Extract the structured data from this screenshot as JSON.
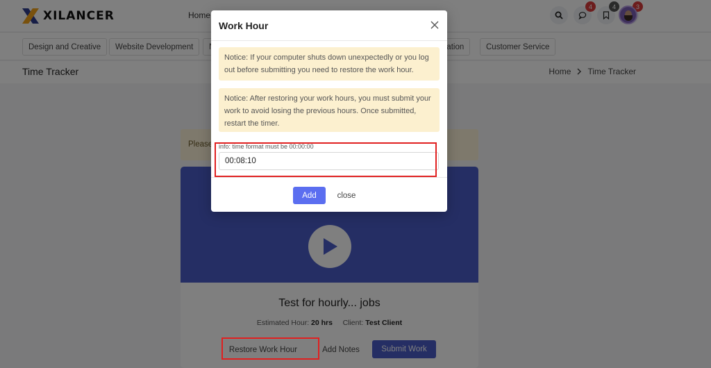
{
  "brand": {
    "name": "XILANCER"
  },
  "nav": {
    "home": "Home"
  },
  "header": {
    "search_icon": "search-icon",
    "messages": {
      "icon": "chat-icon",
      "count": "4"
    },
    "saved": {
      "icon": "bookmark-icon",
      "count": "4"
    },
    "notifications": {
      "icon": "bell-icon",
      "count": "3"
    }
  },
  "categories": [
    "Design and Creative",
    "Website Development",
    "N",
    "slation",
    "Customer Service"
  ],
  "page": {
    "title": "Time Tracker",
    "breadcrumb": [
      "Home",
      "Time Tracker"
    ]
  },
  "content": {
    "notice_prefix": "Please",
    "job_title": "Test for hourly... jobs",
    "estimated_label": "Estimated Hour:",
    "estimated_value": "20 hrs",
    "client_label": "Client:",
    "client_value": "Test Client",
    "restore_label": "Restore Work Hour",
    "notes_label": "Add Notes",
    "submit_label": "Submit Work"
  },
  "modal": {
    "title": "Work Hour",
    "notice1": "Notice: If your computer shuts down unexpectedly or you log out before submitting you need to restore the work hour.",
    "notice2": "Notice: After restoring your work hours, you must submit your work to avoid losing the previous hours. Once submitted, restart the timer.",
    "field_label": "info: time format must be 00:00:00",
    "field_value": "00:08:10",
    "add_label": "Add",
    "close_label": "close"
  },
  "colors": {
    "primary": "#4a5cc9",
    "add_button": "#5b6ef0",
    "badge": "#d93a3a",
    "badge_gray": "#555555",
    "highlight": "#e02020",
    "notice_bg": "#fcf0cf"
  }
}
